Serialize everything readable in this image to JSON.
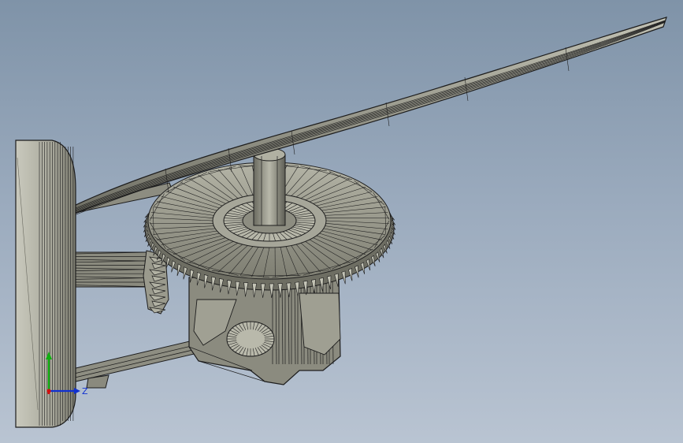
{
  "viewport": {
    "background_top": "#7f93a8",
    "background_bottom": "#b9c4d2"
  },
  "model": {
    "fill_color": "#9c9c8f",
    "edge_color": "#1d1d1d",
    "highlight_color": "#c4c4b6",
    "parts": [
      "wall-mount-plate",
      "blade",
      "bevel-gear",
      "pinion-gear",
      "hub-shaft",
      "gear-housing",
      "support-arm-upper",
      "support-arm-lower"
    ]
  },
  "triad": {
    "z_label": "Z",
    "x_color": "#d01010",
    "y_color": "#10b010",
    "z_color": "#1030d0"
  }
}
